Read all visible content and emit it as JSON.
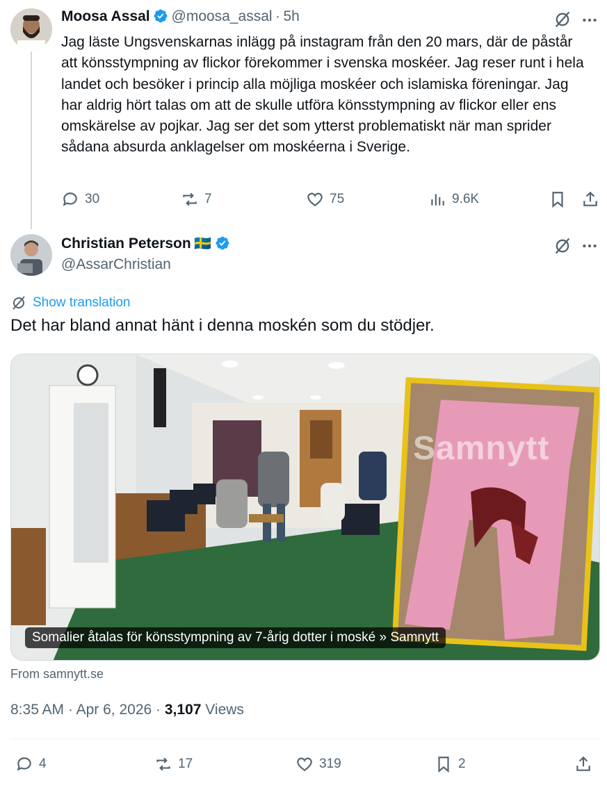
{
  "quoted_tweet": {
    "author_name": "Moosa Assal",
    "handle": "@moosa_assal",
    "separator": "·",
    "time": "5h",
    "text": "Jag  läste Ungsvenskarnas inlägg på instagram från den 20 mars, där de påstår att könsstympning av flickor förekommer i svenska moskéer. Jag reser runt i hela landet och besöker i princip alla möjliga moskéer och islamiska föreningar. Jag har aldrig hört talas om att de skulle utföra könsstympning av flickor eller ens omskärelse av pojkar. Jag ser det som ytterst problematiskt när man sprider sådana absurda anklagelser om moskéerna i Sverige.",
    "replies": "30",
    "reposts": "7",
    "likes": "75",
    "views": "9.6K"
  },
  "main_tweet": {
    "author_name": "Christian Peterson",
    "flag": "🇸🇪",
    "handle": "@AssarChristian",
    "show_translation": "Show translation",
    "text": "Det har bland annat hänt i denna moskén som du stödjer.",
    "card_caption": "Somalier åtalas för könsstympning av 7-årig dotter i moské » Samnytt",
    "watermark": "Samnytt",
    "from": "From samnytt.se",
    "time": "8:35 AM",
    "date": "Apr 6, 2026",
    "dot": "·",
    "views_count": "3,107",
    "views_label": "Views",
    "replies": "4",
    "reposts": "17",
    "likes": "319",
    "bookmarks": "2"
  },
  "colors": {
    "accent": "#1d9bf0",
    "muted": "#536471",
    "text": "#0f1419"
  }
}
